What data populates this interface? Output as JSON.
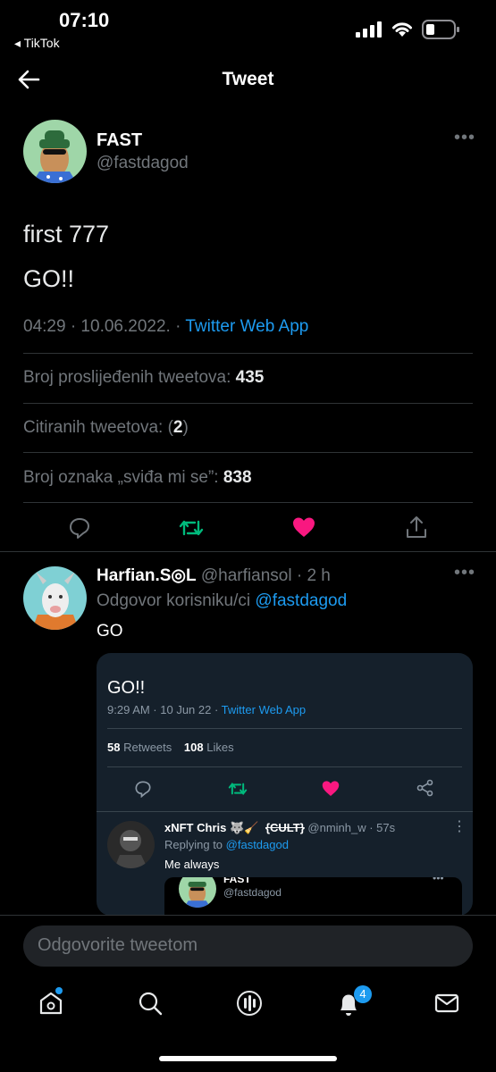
{
  "status_bar": {
    "time": "07:10",
    "back_app": "◂ TikTok"
  },
  "header": {
    "title": "Tweet"
  },
  "tweet": {
    "author_name": "FAST",
    "author_handle": "@fastdagod",
    "lines": [
      "first 777",
      "GO!!"
    ],
    "timestamp": "04:29 · 10.06.2022. · ",
    "source": "Twitter Web App",
    "retweets_label": "Broj proslijeđenih tweetova: ",
    "retweets_count": "435",
    "quotes_label": "Citiranih tweetova: (",
    "quotes_count": "2",
    "quotes_suffix": ")",
    "likes_label": "Broj oznaka „sviđa mi se”: ",
    "likes_count": "838"
  },
  "reply": {
    "author_name": "Harfian.S◎L",
    "author_handle": "@harfiansol",
    "time": " · 2 h",
    "replying_prefix": "Odgovor korisniku/ci ",
    "replying_to": "@fastdagod",
    "text": "GO",
    "embed": {
      "text": "GO!!",
      "meta_time": "9:29 AM · 10 Jun 22 · ",
      "meta_source": "Twitter Web App",
      "retweets_count": "58",
      "retweets_label": " Retweets",
      "likes_count": "108",
      "likes_label": " Likes",
      "nested": {
        "author_name": "xNFT Chris 🐺🧹",
        "struck": "{CULT}",
        "author_handle": "@nminh_w",
        "time": " · 57s",
        "replying_prefix": "Replying to ",
        "replying_to": "@fastdagod",
        "text": "Me always",
        "inner_name": "FAST",
        "inner_handle": "@fastdagod"
      }
    }
  },
  "compose": {
    "placeholder": "Odgovorite tweetom"
  },
  "tabbar": {
    "notifications_badge": "4"
  },
  "colors": {
    "accent": "#1d9bf0",
    "retweet": "#00ba7c",
    "like": "#f91880"
  }
}
